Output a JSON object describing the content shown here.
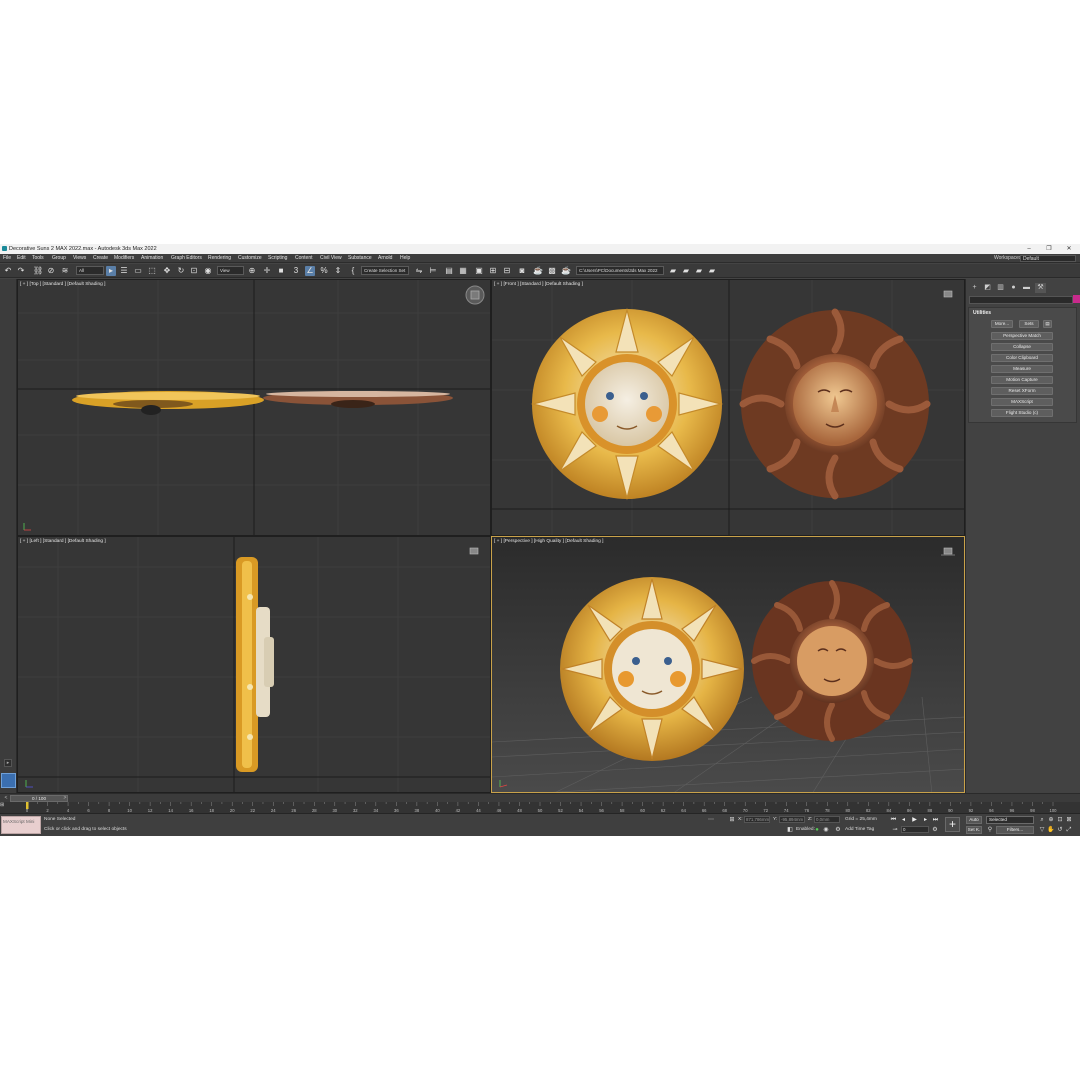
{
  "window": {
    "title": "Decorative Suns 2 MAX 2022.max - Autodesk 3ds Max 2022",
    "minimize_glyph": "–",
    "restore_glyph": "❐",
    "close_glyph": "✕"
  },
  "menu": {
    "items": [
      "File",
      "Edit",
      "Tools",
      "Group",
      "Views",
      "Create",
      "Modifiers",
      "Animation",
      "Graph Editors",
      "Rendering",
      "Customize",
      "Scripting",
      "Content",
      "Civil View",
      "Substance",
      "Arnold",
      "Help"
    ],
    "workspaces_label": "Workspaces:",
    "workspaces_value": "Default"
  },
  "toolbar": {
    "selection_filter": "All",
    "ref_coord": "View",
    "named_selection": "Create Selection Set",
    "project_path": "C:\\Users\\PC\\Documents\\3ds Max 2022"
  },
  "viewports": {
    "top": {
      "label": "[ + ] [Top ] [Standard ] [Default Shading ]"
    },
    "front": {
      "label": "[ + ] [Front ] [Standard ] [Default Shading ]"
    },
    "left": {
      "label": "[ + ] [Left ] [Standard ] [Default Shading ]"
    },
    "perspective": {
      "label": "[ + ] [Perspective ] [High Quality ] [Default Shading ]"
    }
  },
  "command_panel": {
    "tab_icons": [
      "create-icon",
      "modify-icon",
      "hierarchy-icon",
      "motion-icon",
      "display-icon",
      "utilities-icon"
    ],
    "rollout_title": "Utilities",
    "more_label": "More...",
    "sets_label": "Sets",
    "utilities": [
      "Perspective Match",
      "Collapse",
      "Color Clipboard",
      "Measure",
      "Motion Capture",
      "Reset XForm",
      "MAXScript",
      "Flight Studio (c)"
    ]
  },
  "timeline": {
    "frame_display": "0 / 100",
    "ticks": [
      0,
      2,
      4,
      6,
      8,
      10,
      12,
      14,
      16,
      18,
      20,
      22,
      24,
      26,
      28,
      30,
      32,
      34,
      36,
      38,
      40,
      42,
      44,
      46,
      48,
      50,
      52,
      54,
      56,
      58,
      60,
      62,
      64,
      66,
      68,
      70,
      72,
      74,
      76,
      78,
      80,
      82,
      84,
      86,
      88,
      90,
      92,
      94,
      96,
      98,
      100
    ]
  },
  "status": {
    "maxscript_label": "MAXScript Mini",
    "selection": "None Selected",
    "prompt": "Click or click and drag to select objects",
    "x_label": "X:",
    "y_label": "Y:",
    "z_label": "Z:",
    "x_value": "871,786mm",
    "y_value": "-95,894mm",
    "z_value": "0,0mm",
    "grid": "Grid = 25,4mm",
    "enabled_label": "Enabled:",
    "add_time_tag": "Add Time Tag",
    "auto_label": "Auto",
    "selected_value": "Selected",
    "setk_label": "Set K.",
    "filters_label": "Filters...",
    "current_frame": "0"
  },
  "colors": {
    "accent": "#5a7fa8",
    "active_viewport_border": "#c9a24a",
    "maxscript_bg": "#e8cfcf",
    "playhead": "#e0c030"
  }
}
